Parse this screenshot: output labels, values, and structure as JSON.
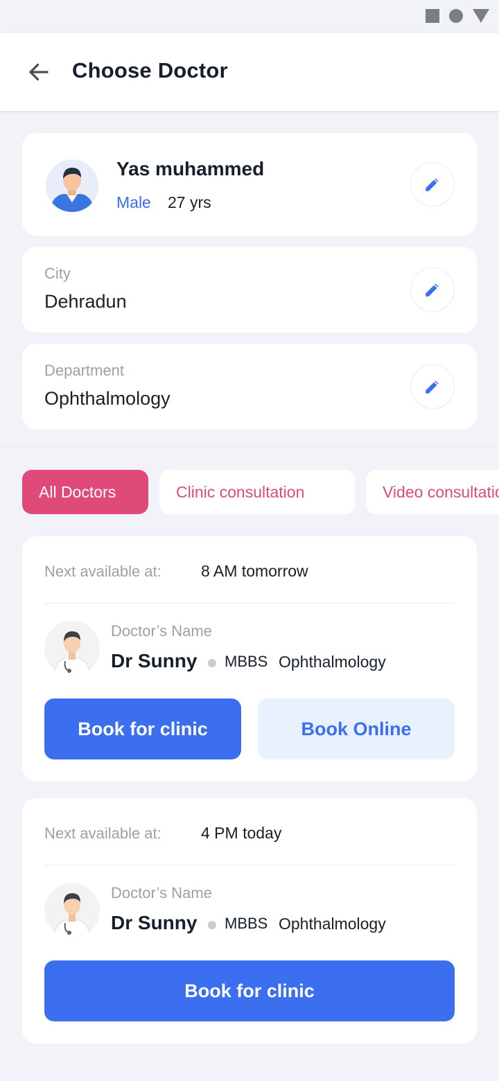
{
  "header": {
    "title": "Choose Doctor"
  },
  "patient": {
    "name": "Yas muhammed",
    "gender": "Male",
    "age": "27 yrs"
  },
  "city": {
    "label": "City",
    "value": "Dehradun"
  },
  "department": {
    "label": "Department",
    "value": "Ophthalmology"
  },
  "filters": [
    {
      "label": "All Doctors",
      "active": true
    },
    {
      "label": "Clinic consultation",
      "active": false
    },
    {
      "label": "Video consultation",
      "active": false
    }
  ],
  "doctors": [
    {
      "available_label": "Next available at:",
      "available_time": "8 AM tomorrow",
      "name_label": "Doctor’s Name",
      "name": "Dr Sunny",
      "degree": "MBBS",
      "specialty": "Ophthalmology",
      "clinic_button": "Book for clinic",
      "online_button": "Book Online"
    },
    {
      "available_label": "Next available at:",
      "available_time": "4 PM today",
      "name_label": "Doctor’s Name",
      "name": "Dr Sunny",
      "degree": "MBBS",
      "specialty": "Ophthalmology",
      "clinic_button": "Book for clinic"
    }
  ],
  "icons": {
    "back": "arrow-left-icon",
    "edit": "pencil-icon",
    "status": [
      "square-icon",
      "circle-icon",
      "triangle-icon"
    ]
  },
  "colors": {
    "accent": "#3b6ff0",
    "chip_active": "#e04a79",
    "background": "#f1f3f8"
  }
}
